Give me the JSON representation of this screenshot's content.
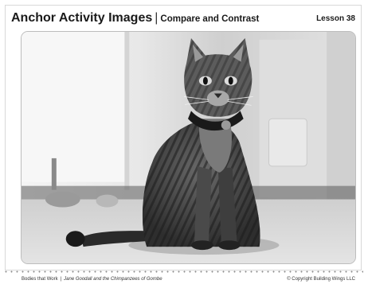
{
  "header": {
    "title_main": "Anchor Activity Images",
    "title_separator": "|",
    "title_sub": "Compare and Contrast",
    "lesson": "Lesson 38"
  },
  "image": {
    "icon": "cat-photo"
  },
  "footer": {
    "unit": "Bodies that Work",
    "separator": "|",
    "book": "Jane Goodall and the Chimpanzees of Gombe",
    "copyright": "© Copyright Building Wings LLC"
  }
}
